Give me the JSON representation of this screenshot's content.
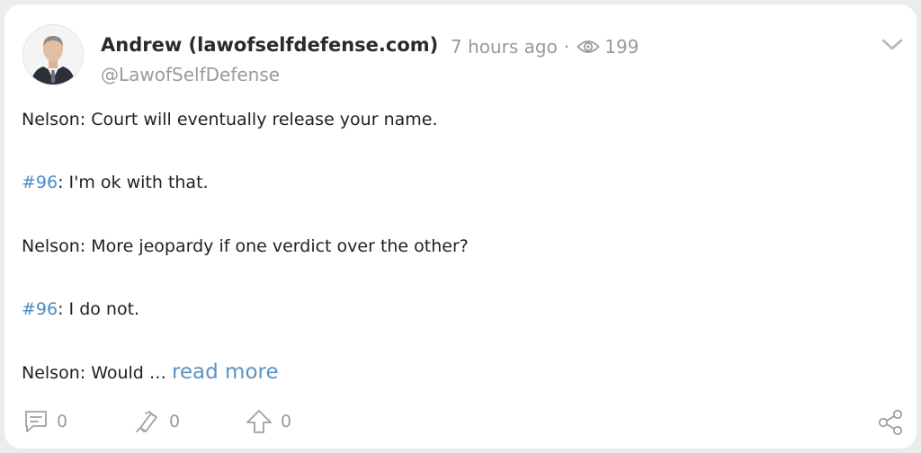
{
  "post": {
    "author_name": "Andrew (lawofselfdefense.com)",
    "time": "7 hours ago",
    "separator": "·",
    "views": "199",
    "handle": "@LawofSelfDefense",
    "paragraphs": {
      "p1": "Nelson: Court will eventually release your name.",
      "p2_tag": "#96",
      "p2_text": ": I'm ok with that.",
      "p3": "Nelson: More jeopardy if one verdict over the other?",
      "p4_tag": "#96",
      "p4_text": ": I do not.",
      "p5": "Nelson: Would … ",
      "read_more": "read more"
    },
    "actions": {
      "comments": "0",
      "reposts": "0",
      "upvotes": "0"
    }
  },
  "icons": [
    "avatar",
    "eye-icon",
    "chevron-down-icon",
    "comment-icon",
    "repost-icon",
    "upvote-icon",
    "share-icon"
  ],
  "colors": {
    "link": "#4a8cc5",
    "muted": "#9a9a9a",
    "background": "#ececec",
    "card": "#ffffff"
  }
}
